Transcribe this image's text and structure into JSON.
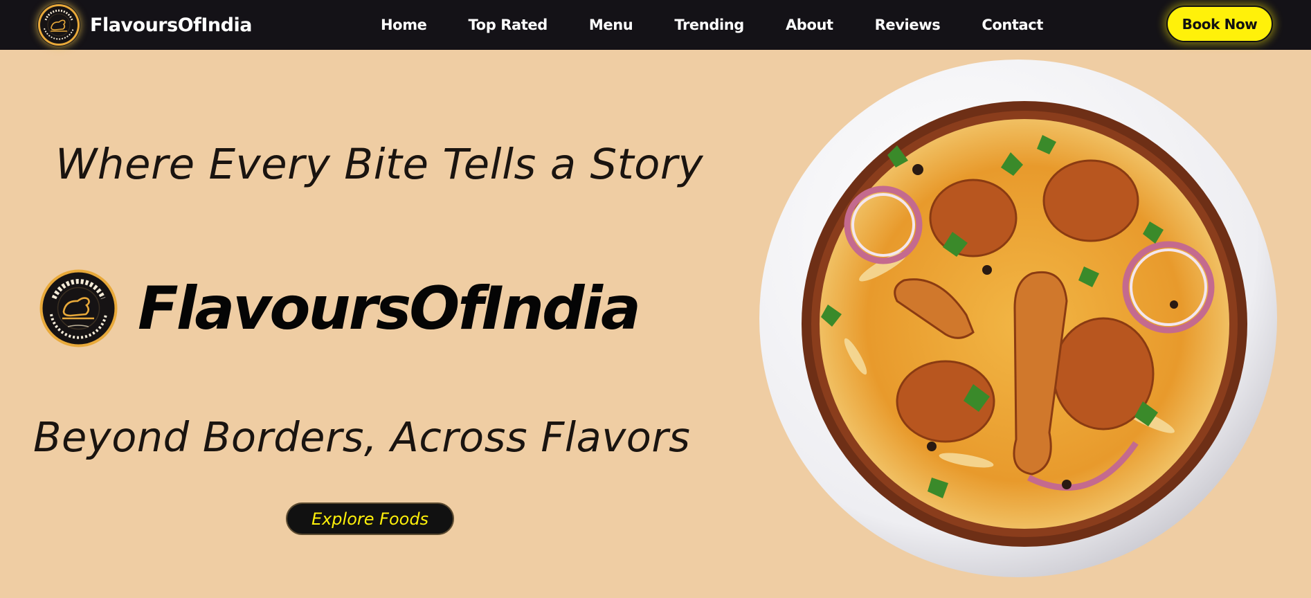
{
  "brand": {
    "name": "FlavoursOfIndia",
    "logo_icon": "chicken-emblem-icon"
  },
  "nav": {
    "links": [
      {
        "label": "Home"
      },
      {
        "label": "Top Rated"
      },
      {
        "label": "Menu"
      },
      {
        "label": "Trending"
      },
      {
        "label": "About"
      },
      {
        "label": "Reviews"
      },
      {
        "label": "Contact"
      }
    ],
    "book_label": "Book Now"
  },
  "hero": {
    "tagline_top": "Where Every Bite Tells a Story",
    "title": "FlavoursOfIndia",
    "tagline_bottom": "Beyond Borders, Across Flavors",
    "explore_label": "Explore Foods",
    "logo_icon": "chicken-emblem-icon",
    "image_icon": "biryani-plate-image"
  },
  "colors": {
    "navbar_bg": "#141217",
    "page_bg": "#efcda3",
    "accent_yellow": "#fff10a",
    "logo_gold": "#e8a93a"
  }
}
